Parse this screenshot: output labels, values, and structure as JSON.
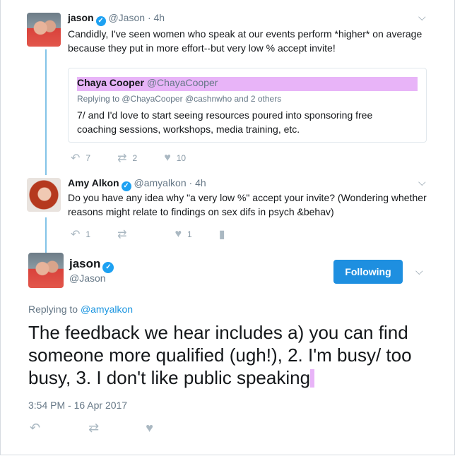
{
  "tweet1": {
    "name": "jason",
    "handle": "@Jason",
    "time": "· 4h",
    "text": "Candidly, I've seen women who speak at our events perform *higher* on average because they put in more effort--but very low % accept invite!",
    "quote": {
      "name": "Chaya Cooper",
      "handle": "@ChayaCooper",
      "replying": "Replying to @ChayaCooper @cashnwho and 2 others",
      "text": "7/ and I'd love to start seeing resources poured into sponsoring free coaching sessions, workshops, media training, etc."
    },
    "replies": "7",
    "retweets": "2",
    "likes": "10"
  },
  "tweet2": {
    "name": "Amy Alkon",
    "handle": "@amyalkon",
    "time": "· 4h",
    "text": "Do you have any idea why \"a very low %\" accept your invite? (Wondering whether reasons might relate to findings on sex difs in psych &behav)",
    "replies": "1",
    "retweets": "",
    "likes": "1"
  },
  "main": {
    "name": "jason",
    "handle": "@Jason",
    "follow_label": "Following",
    "replying_prefix": "Replying to",
    "replying_handle": "@amyalkon",
    "text": "The feedback we hear includes a) you can find someone more qualified (ugh!), 2. I'm busy/ too busy, 3. I don't like public speaking",
    "timestamp": "3:54 PM - 16 Apr 2017"
  },
  "icons": {
    "reply": "reply-icon",
    "retweet": "retweet-icon",
    "like": "heart-icon",
    "analytics": "analytics-icon",
    "verified": "verified-badge-icon",
    "chevron": "chevron-down-icon"
  },
  "colors": {
    "accent": "#1da1f2",
    "button": "#1e8fe0",
    "highlight": "#e8b4f8",
    "thread_line": "#83c3e8",
    "muted": "#657786"
  }
}
